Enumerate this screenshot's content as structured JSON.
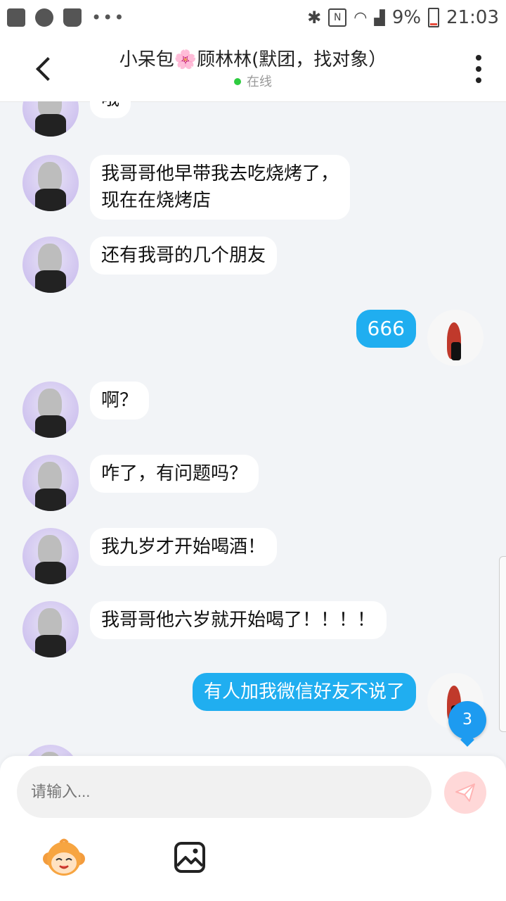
{
  "status_bar": {
    "battery": "9%",
    "time": "21:03",
    "left_icons": [
      "image-icon",
      "check-clock-icon",
      "bag-icon",
      "more-dots-icon"
    ],
    "right_icons": [
      "bluetooth-icon",
      "nfc-icon",
      "wifi-icon",
      "signal-icon",
      "battery-icon"
    ]
  },
  "header": {
    "title_part1": "小呆包",
    "title_flower": "🌸",
    "title_part2": "顾林林(默团，找对象）",
    "status": "在线",
    "status_color": "#2ecc40"
  },
  "messages": [
    {
      "side": "in",
      "text": "哦"
    },
    {
      "side": "in",
      "lines": [
        "我哥哥他早带我去吃烧烤了，",
        "现在在烧烤店"
      ]
    },
    {
      "side": "in",
      "text": "还有我哥的几个朋友"
    },
    {
      "side": "out",
      "text": "666"
    },
    {
      "side": "in",
      "text": "啊？"
    },
    {
      "side": "in",
      "text": "咋了，有问题吗？"
    },
    {
      "side": "in",
      "text": "我九岁才开始喝酒！"
    },
    {
      "side": "in",
      "text": "我哥哥他六岁就开始喝了！！！！"
    },
    {
      "side": "out",
      "text": "有人加我微信好友不说了"
    }
  ],
  "unread_badge": "3",
  "input": {
    "placeholder": "请输入...",
    "value": ""
  },
  "colors": {
    "outgoing_bubble": "#20aef0",
    "incoming_bubble": "#ffffff",
    "send_button": "#ffd8d8",
    "badge": "#1d9bf0"
  }
}
